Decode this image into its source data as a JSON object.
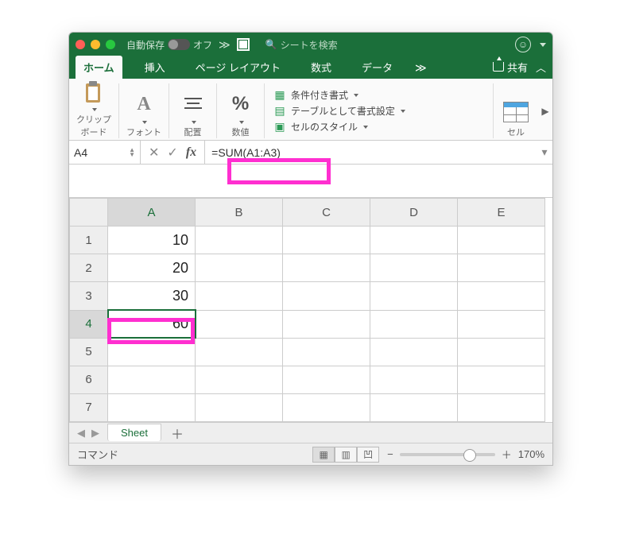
{
  "titlebar": {
    "autosave_label": "自動保存",
    "autosave_state": "オフ",
    "search_placeholder": "シートを検索"
  },
  "tabs": {
    "home": "ホーム",
    "insert": "挿入",
    "page_layout": "ページ レイアウト",
    "formulas": "数式",
    "data": "データ",
    "share": "共有"
  },
  "ribbon": {
    "clipboard": "クリップ\nボード",
    "font": "フォント",
    "align": "配置",
    "number": "数値",
    "cond_fmt": "条件付き書式",
    "table_fmt": "テーブルとして書式設定",
    "cell_styles": "セルのスタイル",
    "cells": "セル"
  },
  "fx": {
    "namebox": "A4",
    "formula": "=SUM(A1:A3)"
  },
  "grid": {
    "cols": [
      "A",
      "B",
      "C",
      "D",
      "E"
    ],
    "rows": [
      "1",
      "2",
      "3",
      "4",
      "5",
      "6",
      "7"
    ],
    "active_col": "A",
    "active_row": "4",
    "cells": {
      "A1": "10",
      "A2": "20",
      "A3": "30",
      "A4": "60"
    }
  },
  "sheet_tabs": {
    "active": "Sheet"
  },
  "status": {
    "mode": "コマンド",
    "zoom": "170%"
  },
  "chart_data": {
    "type": "table",
    "title": "",
    "columns": [
      "A"
    ],
    "rows": [
      {
        "row": 1,
        "A": 10
      },
      {
        "row": 2,
        "A": 20
      },
      {
        "row": 3,
        "A": 30
      },
      {
        "row": 4,
        "A": 60
      }
    ],
    "formulas": {
      "A4": "=SUM(A1:A3)"
    }
  }
}
